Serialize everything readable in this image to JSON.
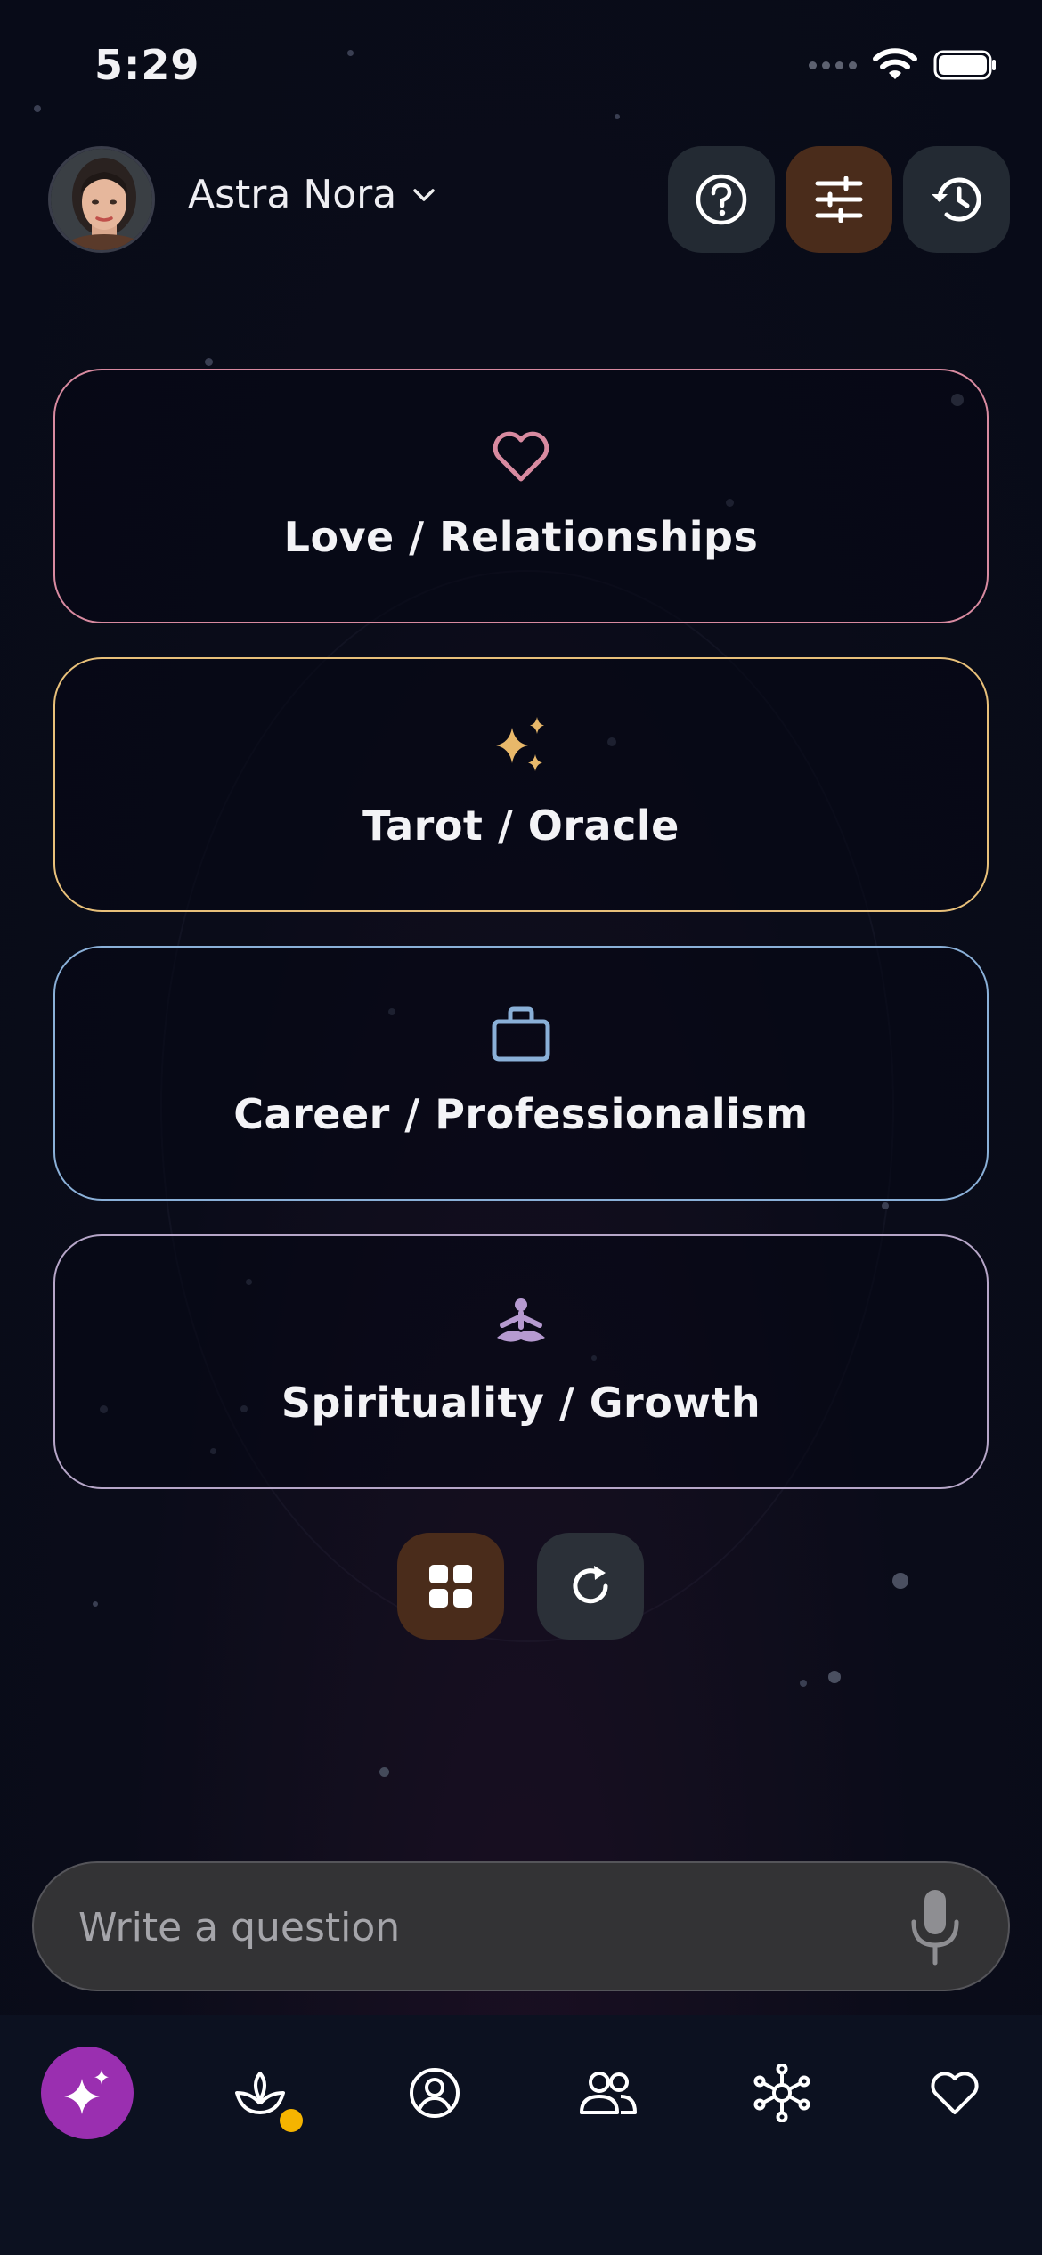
{
  "status_bar": {
    "time": "5:29"
  },
  "profile": {
    "name": "Astra Nora"
  },
  "categories": [
    {
      "label": "Love / Relationships",
      "icon": "heart-icon",
      "color": "#d88aa0"
    },
    {
      "label": "Tarot / Oracle",
      "icon": "sparkles-icon",
      "color": "#e8c07a"
    },
    {
      "label": "Career / Professionalism",
      "icon": "briefcase-icon",
      "color": "#8ab0d8"
    },
    {
      "label": "Spirituality / Growth",
      "icon": "meditation-icon",
      "color": "#b6a6c8"
    }
  ],
  "question": {
    "placeholder": "Write a question"
  },
  "nav": {
    "items": [
      "sparkles-icon",
      "lotus-icon",
      "profile-icon",
      "people-icon",
      "network-icon",
      "heart-icon"
    ],
    "active_color": "#9a2fb0",
    "badge_color": "#f5b400"
  }
}
